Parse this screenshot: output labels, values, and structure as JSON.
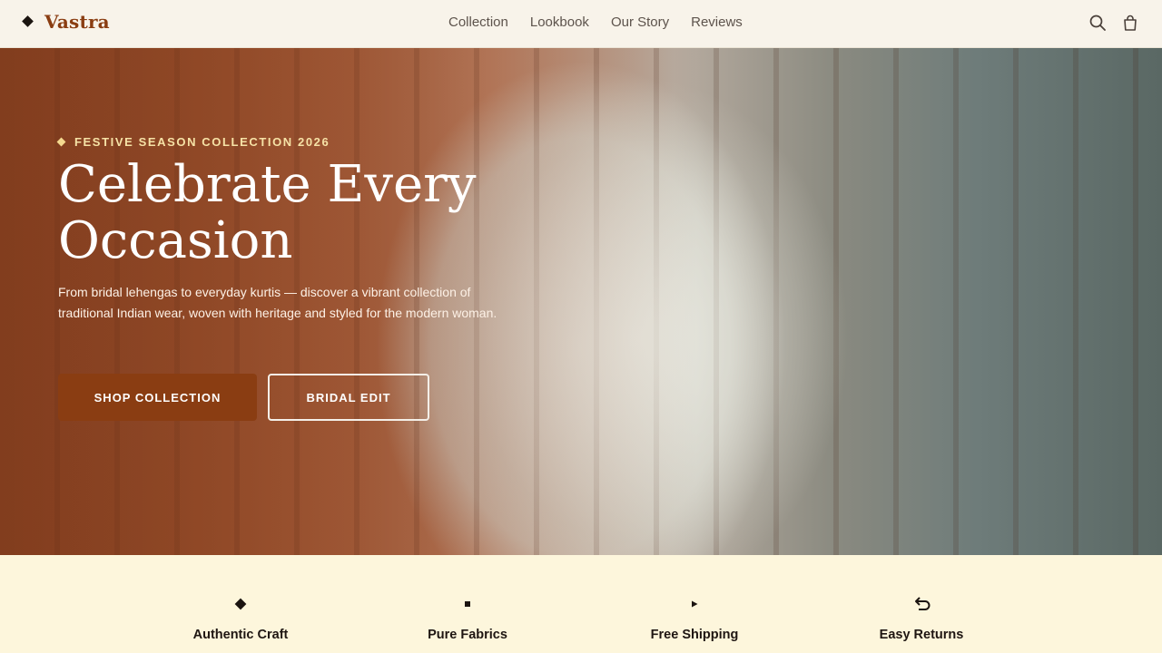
{
  "brand": {
    "name": "Vastra"
  },
  "nav": {
    "items": [
      "Collection",
      "Lookbook",
      "Our Story",
      "Reviews"
    ]
  },
  "header_icons": [
    "search-icon",
    "shopping-bag-icon"
  ],
  "hero": {
    "eyebrow": "FESTIVE SEASON COLLECTION 2026",
    "title_line1": "Celebrate Every",
    "title_line2": "Occasion",
    "description": "From bridal lehengas to everyday kurtis — discover a vibrant collection of traditional Indian wear, woven with heritage and styled for the modern woman.",
    "primary_cta": "SHOP COLLECTION",
    "secondary_cta": "BRIDAL EDIT"
  },
  "features": [
    {
      "icon": "diamond-icon",
      "title": "Authentic Craft"
    },
    {
      "icon": "square-icon",
      "title": "Pure Fabrics"
    },
    {
      "icon": "play-icon",
      "title": "Free Shipping"
    },
    {
      "icon": "return-arrow-icon",
      "title": "Easy Returns"
    }
  ],
  "colors": {
    "accent": "#8a3d12",
    "header_bg": "#f8f3ea",
    "features_bg": "#fdf6dc",
    "eyebrow": "#f6e2a6"
  }
}
